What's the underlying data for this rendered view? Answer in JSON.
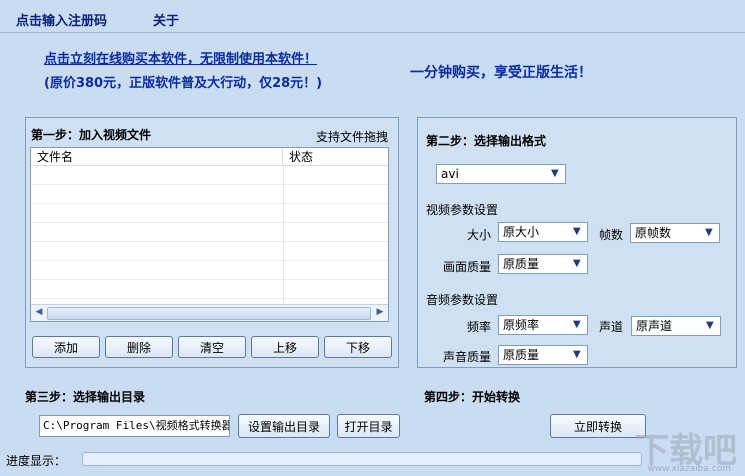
{
  "menu": {
    "register": "点击输入注册码",
    "about": "关于"
  },
  "promo": {
    "line1": "点击立刻在线购买本软件，无限制使用本软件！",
    "line2": "(原价380元，正版软件普及大行动，仅28元！)",
    "right": "一分钟购买，享受正版生活！"
  },
  "step1": {
    "title": "第一步：加入视频文件",
    "drag_hint": "支持文件拖拽",
    "columns": [
      "文件名",
      "状态"
    ],
    "buttons": {
      "add": "添加",
      "delete": "删除",
      "clear": "清空",
      "up": "上移",
      "down": "下移"
    }
  },
  "step2": {
    "title": "第二步：选择输出格式",
    "format": "avi",
    "video_section": "视频参数设置",
    "size_label": "大小",
    "size_value": "原大小",
    "fps_label": "帧数",
    "fps_value": "原帧数",
    "quality_label": "画面质量",
    "quality_value": "原质量",
    "audio_section": "音频参数设置",
    "freq_label": "频率",
    "freq_value": "原频率",
    "channel_label": "声道",
    "channel_value": "原声道",
    "audio_quality_label": "声音质量",
    "audio_quality_value": "原质量"
  },
  "step3": {
    "title": "第三步：选择输出目录",
    "path": "C:\\Program Files\\视频格式转换器",
    "set_button": "设置输出目录",
    "open_button": "打开目录"
  },
  "step4": {
    "title": "第四步：开始转换",
    "convert_button": "立即转换"
  },
  "progress": {
    "label": "进度显示：",
    "fraction": 0
  },
  "watermark": {
    "text": "下载吧",
    "url": "www.xiazaiba.com"
  }
}
